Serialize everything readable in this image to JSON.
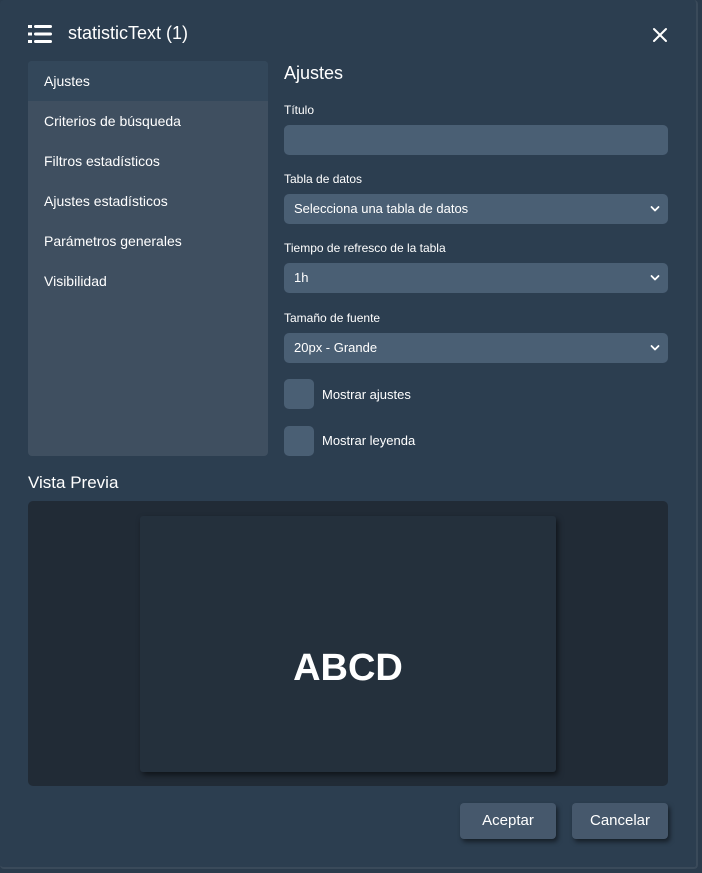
{
  "dialog": {
    "title": "statisticText (1)",
    "icon": "list-icon",
    "close_icon": "close-icon"
  },
  "sidebar": {
    "items": [
      {
        "label": "Ajustes",
        "active": true
      },
      {
        "label": "Criterios de búsqueda",
        "active": false
      },
      {
        "label": "Filtros estadísticos",
        "active": false
      },
      {
        "label": "Ajustes estadísticos",
        "active": false
      },
      {
        "label": "Parámetros generales",
        "active": false
      },
      {
        "label": "Visibilidad",
        "active": false
      }
    ]
  },
  "settings": {
    "section_title": "Ajustes",
    "title_field": {
      "label": "Título",
      "value": ""
    },
    "data_table": {
      "label": "Tabla de datos",
      "value": "Selecciona una tabla de datos"
    },
    "refresh_time": {
      "label": "Tiempo de refresco de la tabla",
      "value": "1h"
    },
    "font_size": {
      "label": "Tamaño de fuente",
      "value": "20px - Grande"
    },
    "show_settings": {
      "label": "Mostrar ajustes",
      "checked": false
    },
    "show_legend": {
      "label": "Mostrar leyenda",
      "checked": false
    }
  },
  "preview": {
    "title": "Vista Previa",
    "text": "ABCD"
  },
  "footer": {
    "accept_label": "Aceptar",
    "cancel_label": "Cancelar"
  },
  "colors": {
    "dialog_bg": "#2c3e50",
    "sidebar_bg": "#3f4f60",
    "input_bg": "#4a5f74",
    "preview_bg": "#212b36",
    "button_bg": "#46586c"
  }
}
